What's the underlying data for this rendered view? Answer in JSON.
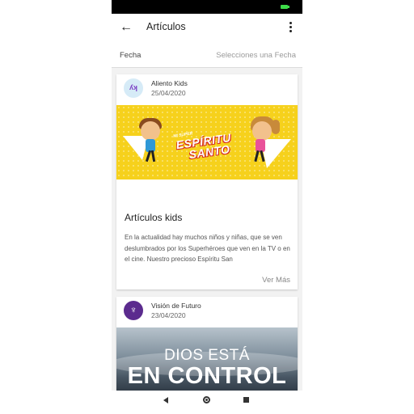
{
  "header": {
    "title": "Artículos"
  },
  "filter": {
    "label": "Fecha",
    "value": "Selecciones una Fecha"
  },
  "articles": [
    {
      "author": "Aliento Kids",
      "date": "25/04/2020",
      "avatar_icon": "aliento-kids-logo-icon",
      "banner_small": "MI SUPER",
      "banner_big1": "ESPÍRITU",
      "banner_big2": "SANTO",
      "title": "Artículos kids",
      "excerpt": "En la actualidad hay muchos niños y niñas, que se ven deslumbrados por los Superhéroes que ven en la TV o en el cine. Nuestro precioso Espíritu San",
      "more_label": "Ver Más"
    },
    {
      "author": "Visión de Futuro",
      "date": "23/04/2020",
      "avatar_icon": "vision-de-futuro-logo-icon",
      "banner_line1": "DIOS ESTÁ",
      "banner_line2": "EN CONTROL"
    }
  ],
  "colors": {
    "banner_yellow": "#f6d11c",
    "avatar_purple": "#5b2b8e",
    "battery_green": "#3ddc48"
  }
}
